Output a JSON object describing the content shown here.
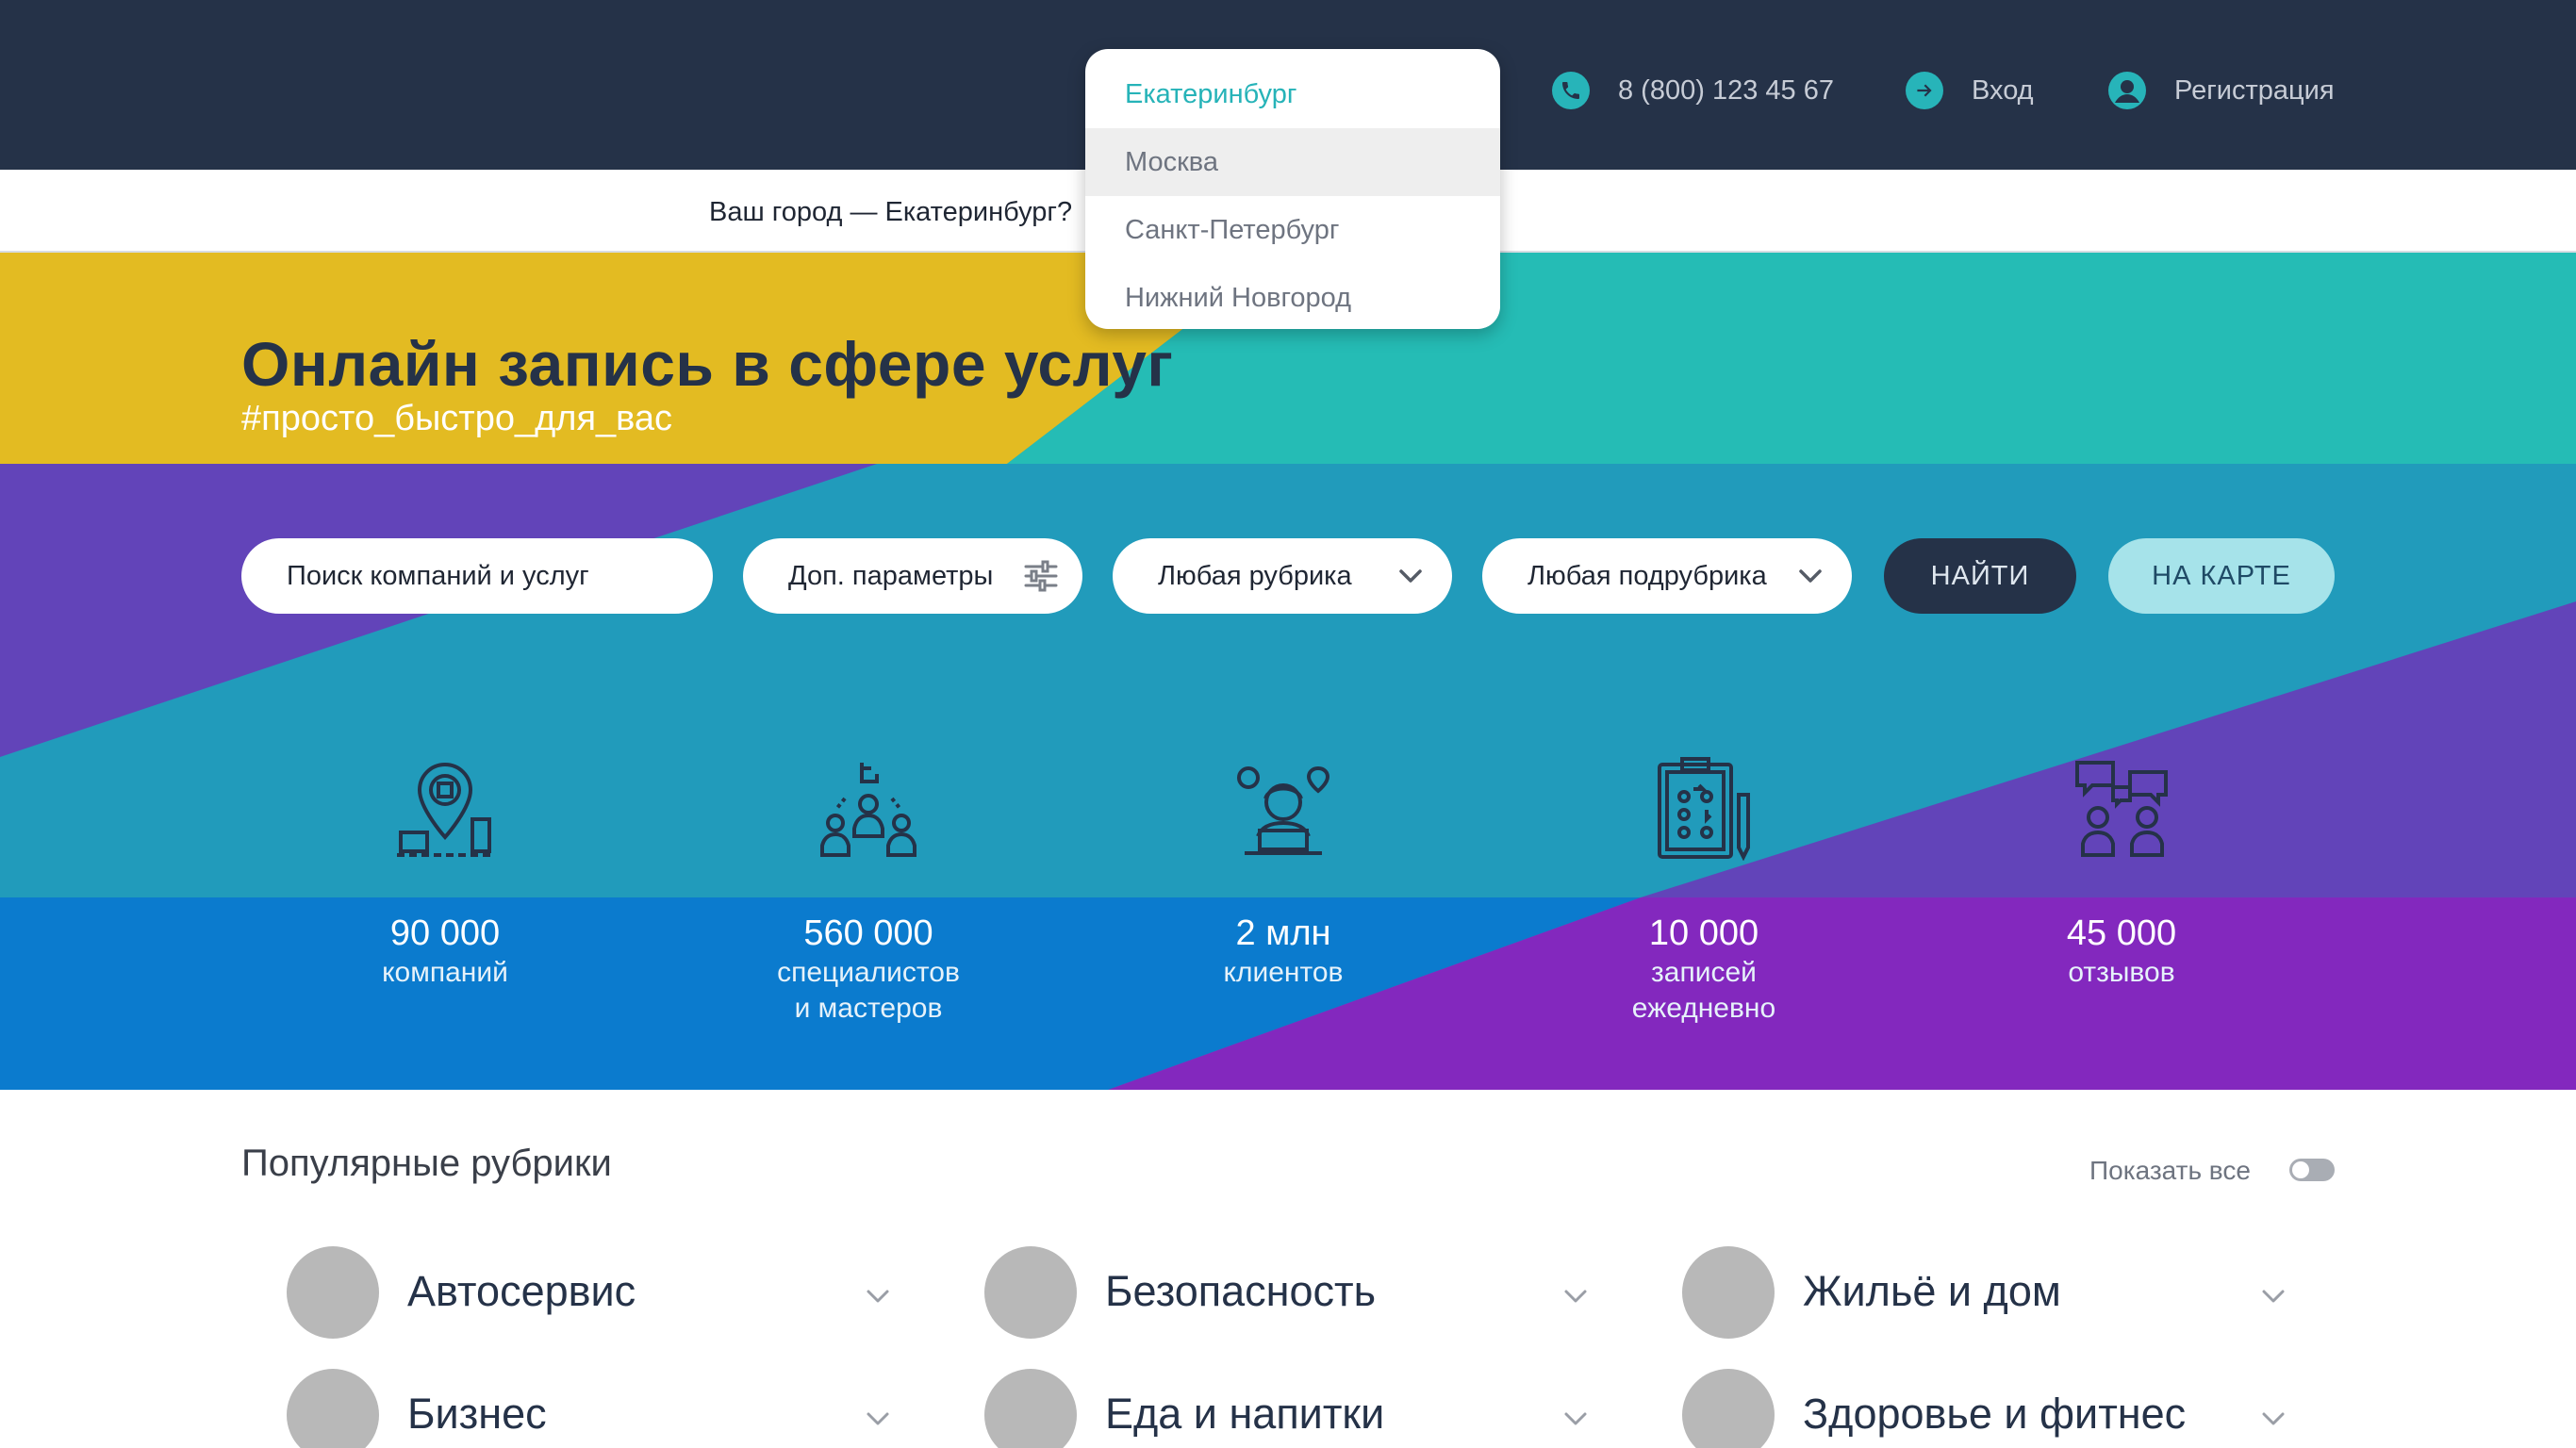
{
  "header": {
    "phone": "8 (800) 123 45 67",
    "login": "Вход",
    "register": "Регистрация",
    "icons": {
      "phone": "phone-icon",
      "login": "login-arrow-icon",
      "register": "user-icon"
    },
    "colors": {
      "bg": "#253248",
      "accent": "#27b4b9"
    }
  },
  "city_bar": {
    "question": "Ваш город — Екатеринбург?"
  },
  "city_dropdown": {
    "selected": "Екатеринбург",
    "options": [
      "Екатеринбург",
      "Москва",
      "Санкт-Петербург",
      "Нижний Новгород"
    ],
    "hovered": "Москва"
  },
  "hero": {
    "title": "Онлайн запись в сфере услуг",
    "subtitle": "#просто_быстро_для_вас",
    "colors": {
      "yellow": "#e3bb22",
      "teal": "#25bcb5",
      "purple": "#6244b9",
      "blue": "#219bbb",
      "deep_blue": "#0b7bce",
      "violet": "#8328be"
    }
  },
  "search": {
    "query_placeholder": "Поиск компаний и услуг",
    "params_label": "Доп. параметры",
    "rubric_label": "Любая рубрика",
    "subrubric_label": "Любая подрубрика",
    "find_button": "НАЙТИ",
    "map_button": "НА КАРТЕ",
    "icons": {
      "params": "sliders-icon",
      "dropdown": "chevron-down-icon"
    }
  },
  "stats": [
    {
      "value": "90 000",
      "label_1": "компаний",
      "label_2": "",
      "icon": "map-pin-buildings-icon"
    },
    {
      "value": "560 000",
      "label_1": "специалистов",
      "label_2": "и мастеров",
      "icon": "specialists-group-icon"
    },
    {
      "value": "2 млн",
      "label_1": "клиентов",
      "label_2": "",
      "icon": "client-laptop-icon"
    },
    {
      "value": "10 000",
      "label_1": "записей",
      "label_2": "ежедневно",
      "icon": "clipboard-pen-icon"
    },
    {
      "value": "45 000",
      "label_1": "отзывов",
      "label_2": "",
      "icon": "people-chat-icon"
    }
  ],
  "popular": {
    "title": "Популярные рубрики",
    "show_all": "Показать все",
    "show_all_enabled": false,
    "categories": [
      {
        "name": "Автосервис"
      },
      {
        "name": "Безопасность"
      },
      {
        "name": "Жильё и дом"
      },
      {
        "name": "Бизнес"
      },
      {
        "name": "Еда и напитки"
      },
      {
        "name": "Здоровье и фитнес"
      }
    ]
  }
}
